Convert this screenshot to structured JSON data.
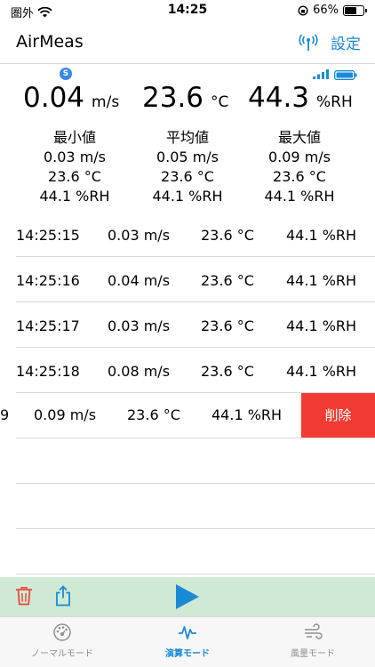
{
  "status": {
    "carrier": "圏外",
    "time": "14:25",
    "battery": "66%",
    "battery_level": 0.66
  },
  "header": {
    "title": "AirMeas",
    "settings": "設定"
  },
  "live": {
    "badge": "S",
    "speed": {
      "value": "0.04",
      "unit": "m/s"
    },
    "temp": {
      "value": "23.6",
      "unit": "°C"
    },
    "humidity": {
      "value": "44.3",
      "unit": "%RH"
    }
  },
  "stats": [
    {
      "label": "最小値",
      "speed": "0.03 m/s",
      "temp": "23.6 °C",
      "humidity": "44.1 %RH"
    },
    {
      "label": "平均値",
      "speed": "0.05 m/s",
      "temp": "23.6 °C",
      "humidity": "44.1 %RH"
    },
    {
      "label": "最大値",
      "speed": "0.09 m/s",
      "temp": "23.6 °C",
      "humidity": "44.1 %RH"
    }
  ],
  "rows": [
    {
      "time": "14:25:15",
      "speed": "0.03 m/s",
      "temp": "23.6 °C",
      "humidity": "44.1 %RH"
    },
    {
      "time": "14:25:16",
      "speed": "0.04 m/s",
      "temp": "23.6 °C",
      "humidity": "44.1 %RH"
    },
    {
      "time": "14:25:17",
      "speed": "0.03 m/s",
      "temp": "23.6 °C",
      "humidity": "44.1 %RH"
    },
    {
      "time": "14:25:18",
      "speed": "0.08 m/s",
      "temp": "23.6 °C",
      "humidity": "44.1 %RH"
    },
    {
      "time": "9",
      "speed": "0.09 m/s",
      "temp": "23.6 °C",
      "humidity": "44.1 %RH"
    }
  ],
  "delete_label": "削除",
  "tabs": [
    {
      "label": "ノーマルモード",
      "icon": "dial-icon",
      "active": false
    },
    {
      "label": "演算モード",
      "icon": "pulse-icon",
      "active": true
    },
    {
      "label": "風量モード",
      "icon": "wind-icon",
      "active": false
    }
  ],
  "colors": {
    "accent": "#1a8ad6",
    "delete": "#f23b32",
    "toolbar_bg": "#cfe9d5",
    "trash": "#e74c3c"
  }
}
